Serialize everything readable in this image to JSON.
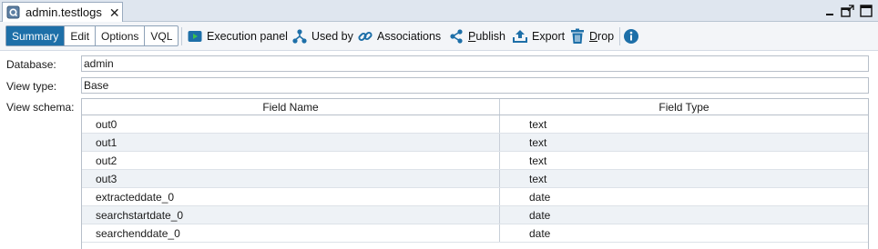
{
  "tab": {
    "title": "admin.testlogs",
    "close_glyph": "✕",
    "icon": "view-document-icon"
  },
  "window_controls": {
    "minimize_glyph": "_",
    "icons": [
      "minimize-icon",
      "maximize-icon",
      "restore-icon"
    ]
  },
  "toolbar": {
    "view_tabs": [
      {
        "label": "Summary",
        "active": true
      },
      {
        "label": "Edit",
        "active": false
      },
      {
        "label": "Options",
        "active": false
      },
      {
        "label": "VQL",
        "active": false
      }
    ],
    "actions": {
      "execution_panel": "Execution panel",
      "used_by": "Used by",
      "associations": "Associations",
      "publish_first": "P",
      "publish_rest": "ublish",
      "export": "Export",
      "drop_first": "D",
      "drop_rest": "rop"
    },
    "icons": [
      "execution-panel-icon",
      "used-by-icon",
      "associations-icon",
      "share-icon",
      "export-icon",
      "trash-icon",
      "info-icon"
    ],
    "accent_color": "#1d6fa8"
  },
  "form": {
    "database_label": "Database:",
    "database_value": "admin",
    "view_type_label": "View type:",
    "view_type_value": "Base",
    "view_schema_label": "View schema:"
  },
  "schema": {
    "columns": [
      "Field Name",
      "Field Type"
    ],
    "rows": [
      {
        "name": "out0",
        "type": "text"
      },
      {
        "name": "out1",
        "type": "text"
      },
      {
        "name": "out2",
        "type": "text"
      },
      {
        "name": "out3",
        "type": "text"
      },
      {
        "name": "extracteddate_0",
        "type": "date"
      },
      {
        "name": "searchstartdate_0",
        "type": "date"
      },
      {
        "name": "searchenddate_0",
        "type": "date"
      }
    ]
  }
}
